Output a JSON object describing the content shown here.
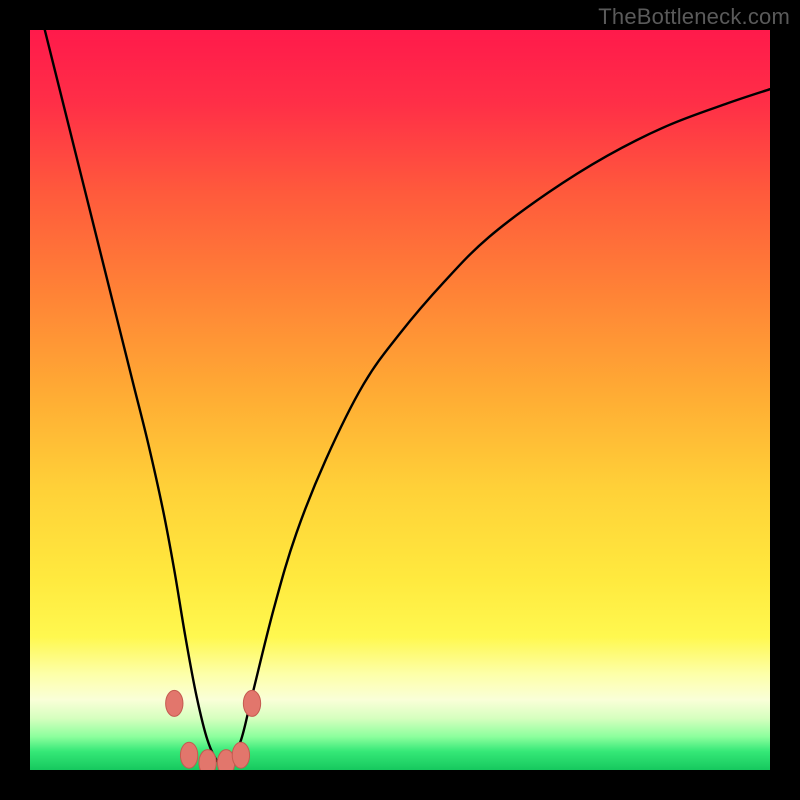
{
  "watermark": {
    "text": "TheBottleneck.com"
  },
  "colors": {
    "black": "#000000",
    "curve": "#000000",
    "marker_fill": "#e2766c",
    "marker_stroke": "#c45a50",
    "gradient_stops": [
      {
        "offset": 0.0,
        "color": "#ff1a4b"
      },
      {
        "offset": 0.1,
        "color": "#ff2f47"
      },
      {
        "offset": 0.22,
        "color": "#ff5a3c"
      },
      {
        "offset": 0.36,
        "color": "#ff8436"
      },
      {
        "offset": 0.5,
        "color": "#ffae34"
      },
      {
        "offset": 0.62,
        "color": "#ffd138"
      },
      {
        "offset": 0.74,
        "color": "#ffe93e"
      },
      {
        "offset": 0.82,
        "color": "#fff84f"
      },
      {
        "offset": 0.87,
        "color": "#fdffa8"
      },
      {
        "offset": 0.905,
        "color": "#faffd8"
      },
      {
        "offset": 0.93,
        "color": "#d6ffbf"
      },
      {
        "offset": 0.955,
        "color": "#8cff9d"
      },
      {
        "offset": 0.975,
        "color": "#35e877"
      },
      {
        "offset": 1.0,
        "color": "#16c85e"
      }
    ]
  },
  "chart_data": {
    "type": "line",
    "title": "",
    "xlabel": "",
    "ylabel": "",
    "xlim": [
      0,
      100
    ],
    "ylim": [
      0,
      100
    ],
    "grid": false,
    "legend": false,
    "series": [
      {
        "name": "bottleneck-curve",
        "x": [
          2,
          4,
          6,
          8,
          10,
          12,
          14,
          16,
          18,
          19.5,
          21,
          22.5,
          24,
          25.5,
          27,
          28.5,
          30,
          33,
          36,
          40,
          45,
          50,
          56,
          62,
          70,
          78,
          86,
          94,
          100
        ],
        "y": [
          100,
          92,
          84,
          76,
          68,
          60,
          52,
          44,
          35,
          27,
          18,
          10,
          4,
          1,
          1,
          4,
          10,
          22,
          32,
          42,
          52,
          59,
          66,
          72,
          78,
          83,
          87,
          90,
          92
        ]
      }
    ],
    "markers": [
      {
        "x": 19.5,
        "y": 9,
        "r": 1.3
      },
      {
        "x": 21.5,
        "y": 2,
        "r": 1.3
      },
      {
        "x": 24.0,
        "y": 1,
        "r": 1.3
      },
      {
        "x": 26.5,
        "y": 1,
        "r": 1.3
      },
      {
        "x": 28.5,
        "y": 2,
        "r": 1.3
      },
      {
        "x": 30.0,
        "y": 9,
        "r": 1.3
      }
    ],
    "optimum_x": 25
  }
}
